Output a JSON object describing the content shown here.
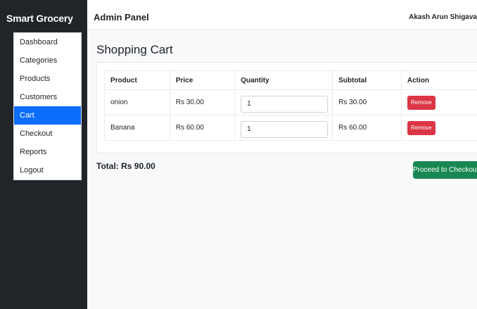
{
  "sidebar": {
    "brand": "Smart Grocery",
    "items": [
      {
        "label": "Dashboard"
      },
      {
        "label": "Categories"
      },
      {
        "label": "Products"
      },
      {
        "label": "Customers"
      },
      {
        "label": "Cart",
        "active": true
      },
      {
        "label": "Checkout"
      },
      {
        "label": "Reports"
      },
      {
        "label": "Logout"
      }
    ]
  },
  "header": {
    "title": "Admin Panel",
    "user": "Akash Arun Shigava"
  },
  "main": {
    "title": "Shopping Cart",
    "table": {
      "headers": [
        "Product",
        "Price",
        "Quantity",
        "Subtotal",
        "Action"
      ],
      "rows": [
        {
          "product": "onion",
          "price": "Rs 30.00",
          "quantity": "1",
          "subtotal": "Rs 30.00",
          "action": "Remove"
        },
        {
          "product": "Banana",
          "price": "Rs 60.00",
          "quantity": "1",
          "subtotal": "Rs 60.00",
          "action": "Remove"
        }
      ]
    },
    "total": "Total: Rs 90.00",
    "checkout_label": "Proceed to Checkout"
  },
  "colors": {
    "sidebar_bg": "#212529",
    "active_item": "#0d6efd",
    "remove_button": "#dc3545",
    "checkout_button": "#198754"
  }
}
